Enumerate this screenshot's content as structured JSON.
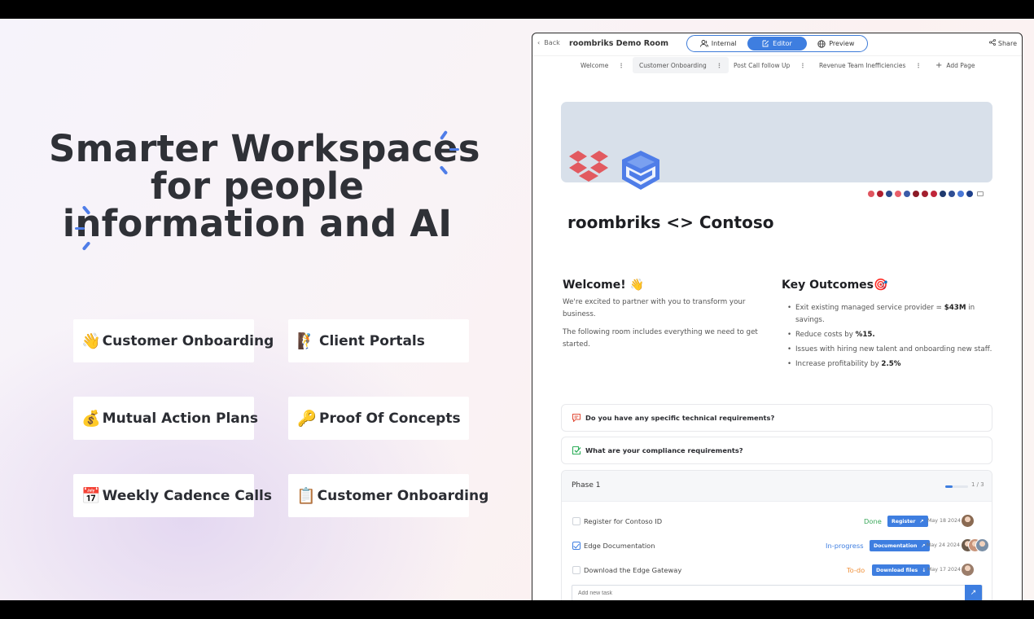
{
  "hero": {
    "line1": "Smarter Workspaces",
    "line2": "for people",
    "line3": "information and AI"
  },
  "features": [
    {
      "emoji": "👋",
      "label": "Customer Onboarding"
    },
    {
      "emoji": "🧗",
      "label": "Client Portals"
    },
    {
      "emoji": "💰",
      "label": "Mutual Action Plans"
    },
    {
      "emoji": "🔑",
      "label": "Proof Of Concepts"
    },
    {
      "emoji": "📅",
      "label": "Weekly Cadence Calls"
    },
    {
      "emoji": "📋",
      "label": "Customer Onboarding"
    }
  ],
  "app": {
    "back_label": "Back",
    "room_title": "roombriks Demo Room",
    "view_modes": [
      {
        "label": "Internal",
        "icon": "users-icon"
      },
      {
        "label": "Editor",
        "icon": "edit-icon",
        "active": true
      },
      {
        "label": "Preview",
        "icon": "globe-icon"
      }
    ],
    "share_label": "Share",
    "pages": [
      {
        "label": "Welcome"
      },
      {
        "label": "Customer Onboarding",
        "active": true
      },
      {
        "label": "Post Call follow Up"
      },
      {
        "label": "Revenue Team Inefficiencies"
      }
    ],
    "add_page_label": "Add Page",
    "swatch_colors": [
      "#e0555f",
      "#b01e2d",
      "#2c4a8c",
      "#ea5f6a",
      "#3b5ba8",
      "#8b1a26",
      "#a3202f",
      "#c0263a",
      "#1f3a6e",
      "#2f4e94",
      "#4a78d6",
      "#1d3f8a"
    ],
    "doc_title": "roombriks <> Contoso",
    "welcome": {
      "heading": "Welcome! 👋",
      "para1": "We're excited to partner with you to transform your business.",
      "para2": "The following room includes everything we need to get started."
    },
    "outcomes": {
      "heading": "Key Outcomes🎯",
      "items": [
        {
          "text": "Exit existing managed service provider = ",
          "bold": "$43M",
          "after": " in savings."
        },
        {
          "text": "Reduce costs by ",
          "bold": "%15.",
          "after": ""
        },
        {
          "text": "Issues with hiring new talent and onboarding new staff.",
          "bold": "",
          "after": ""
        },
        {
          "text": "Increase profitability by ",
          "bold": "2.5%",
          "after": ""
        }
      ]
    },
    "faq": [
      {
        "question": "Do you have any specific technical requirements?",
        "icon": "chat-icon",
        "color": "#e2533f"
      },
      {
        "question": "What are your compliance requirements?",
        "icon": "check-icon",
        "color": "#2fae5b"
      }
    ],
    "phase": {
      "title": "Phase 1",
      "progress_label": "1 / 3",
      "progress": 0.33,
      "tasks": [
        {
          "name": "Register for Contoso ID",
          "status": "Done",
          "status_color": "#3aa85a",
          "button": "Register",
          "button_icon": "↗",
          "date": "May 18 2024",
          "checked": false,
          "avatars": [
            "#8a6a52"
          ]
        },
        {
          "name": "Edge Documentation",
          "status": "In-progress",
          "status_color": "#3e7ee0",
          "button": "Documentation",
          "button_icon": "↗",
          "date": "May 24 2024",
          "checked": true,
          "avatars": [
            "#6b5a4a",
            "#c8947a",
            "#7a8fa6"
          ]
        },
        {
          "name": "Download the Edge Gateway",
          "status": "To-do",
          "status_color": "#f0913a",
          "button": "Download files",
          "button_icon": "↓",
          "date": "May 17 2024",
          "checked": false,
          "avatars": [
            "#9b7d6a"
          ]
        }
      ],
      "new_task_placeholder": "Add new task"
    }
  }
}
